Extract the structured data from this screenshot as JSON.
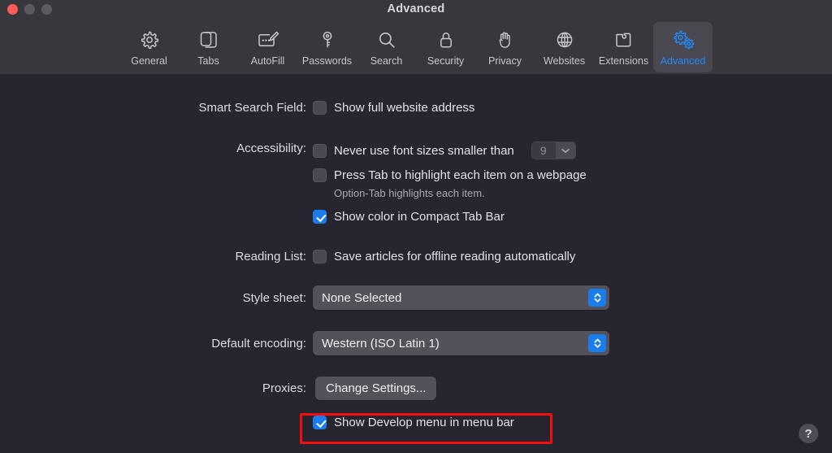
{
  "window": {
    "title": "Advanced",
    "traffic_lights": [
      "close-button",
      "minimize-button",
      "zoom-button"
    ]
  },
  "toolbar": {
    "items": [
      {
        "label": "General",
        "icon": "gear-icon",
        "selected": false
      },
      {
        "label": "Tabs",
        "icon": "tabs-icon",
        "selected": false
      },
      {
        "label": "AutoFill",
        "icon": "autofill-icon",
        "selected": false
      },
      {
        "label": "Passwords",
        "icon": "key-icon",
        "selected": false
      },
      {
        "label": "Search",
        "icon": "search-icon",
        "selected": false
      },
      {
        "label": "Security",
        "icon": "lock-icon",
        "selected": false
      },
      {
        "label": "Privacy",
        "icon": "hand-icon",
        "selected": false
      },
      {
        "label": "Websites",
        "icon": "globe-icon",
        "selected": false
      },
      {
        "label": "Extensions",
        "icon": "puzzle-icon",
        "selected": false
      },
      {
        "label": "Advanced",
        "icon": "double-gear-icon",
        "selected": true
      }
    ]
  },
  "settings": {
    "smart_search_field": {
      "label": "Smart Search Field:",
      "checkbox": {
        "text": "Show full website address",
        "checked": false
      }
    },
    "accessibility": {
      "label": "Accessibility:",
      "min_font": {
        "text": "Never use font sizes smaller than",
        "checked": false,
        "value": "9"
      },
      "tab_highlight": {
        "text": "Press Tab to highlight each item on a webpage",
        "checked": false
      },
      "tab_hint": "Option-Tab highlights each item.",
      "compact_tab_color": {
        "text": "Show color in Compact Tab Bar",
        "checked": true
      }
    },
    "reading_list": {
      "label": "Reading List:",
      "checkbox": {
        "text": "Save articles for offline reading automatically",
        "checked": false
      }
    },
    "style_sheet": {
      "label": "Style sheet:",
      "value": "None Selected"
    },
    "default_encoding": {
      "label": "Default encoding:",
      "value": "Western (ISO Latin 1)"
    },
    "proxies": {
      "label": "Proxies:",
      "button": "Change Settings..."
    },
    "develop_menu": {
      "text": "Show Develop menu in menu bar",
      "checked": true
    }
  },
  "help": {
    "glyph": "?"
  },
  "annotation": {
    "color": "#f60d0d",
    "target": "develop-menu-checkbox-row"
  },
  "colors": {
    "titlebar": "#38373d",
    "content": "#272530",
    "accent": "#1a7ced",
    "selected_tab_bg": "#4a4951",
    "annotation_red": "#f60d0d"
  }
}
